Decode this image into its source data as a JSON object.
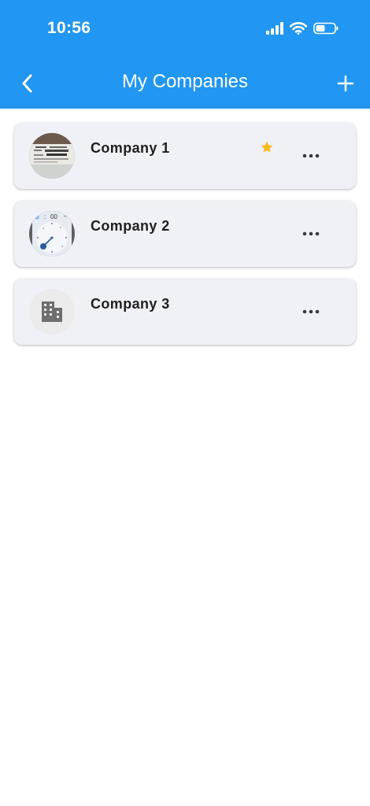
{
  "status_bar": {
    "time": "10:56"
  },
  "header": {
    "title": "My Companies",
    "back_icon": "chevron-left-icon",
    "add_icon": "plus-icon",
    "background_color": "#2196f3"
  },
  "companies": [
    {
      "name": "Company 1",
      "favorite": true,
      "avatar": "receipt-photo"
    },
    {
      "name": "Company 2",
      "favorite": false,
      "avatar": "clock-screenshot"
    },
    {
      "name": "Company 3",
      "favorite": false,
      "avatar": "building-icon"
    }
  ],
  "colors": {
    "card_background": "#f0f0f7",
    "star": "#f6bc1c"
  }
}
